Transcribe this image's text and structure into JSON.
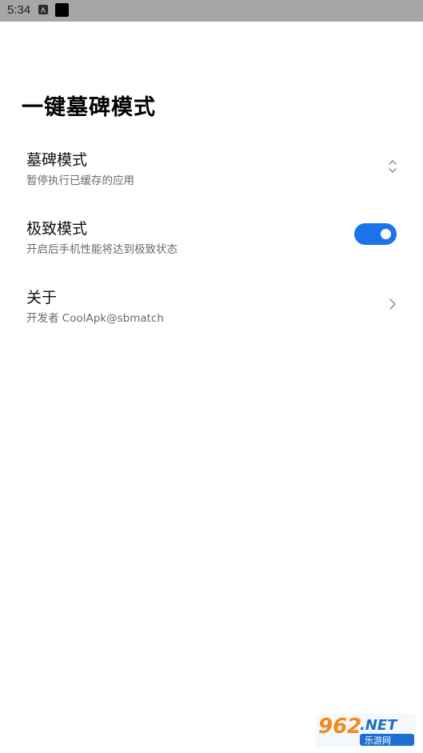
{
  "status_bar": {
    "time": "5:34"
  },
  "page": {
    "title": "一键墓碑模式"
  },
  "settings": [
    {
      "title": "墓碑模式",
      "subtitle": "暂停执行已缓存的应用",
      "control": "up-down-icon"
    },
    {
      "title": "极致模式",
      "subtitle": "开启后手机性能将达到极致状态",
      "control": "toggle",
      "toggle_on": true
    },
    {
      "title": "关于",
      "subtitle": "开发者 CoolApk@sbmatch",
      "control": "chevron-right-icon"
    }
  ],
  "watermark": {
    "brand": "962.NET",
    "subtitle": "乐游网"
  },
  "colors": {
    "accent": "#1a73e8",
    "status_bar": "#a6a6a6",
    "watermark_orange": "#f08a1c",
    "watermark_blue": "#1e6ecf"
  }
}
